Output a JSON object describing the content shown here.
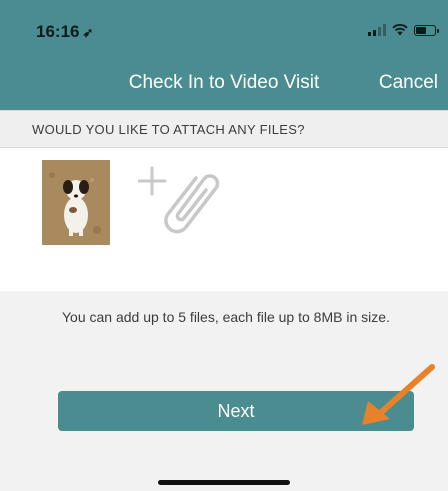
{
  "status_bar": {
    "time": "16:16",
    "location_icon": "location-arrow-icon",
    "icons": [
      "signal-icon",
      "wifi-icon",
      "battery-icon"
    ]
  },
  "nav": {
    "title": "Check In to Video Visit",
    "cancel_label": "Cancel"
  },
  "section": {
    "header": "WOULD YOU LIKE TO ATTACH ANY FILES?"
  },
  "attachments": {
    "items": [
      {
        "type": "image",
        "icon": "dog-photo-thumbnail"
      }
    ],
    "add_icon": "add-attachment-icon"
  },
  "hint": {
    "text": "You can add up to 5 files, each file up to 8MB in size."
  },
  "actions": {
    "next_label": "Next"
  },
  "colors": {
    "accent": "#4a8c8f",
    "annotation_arrow": "#e8822a"
  }
}
